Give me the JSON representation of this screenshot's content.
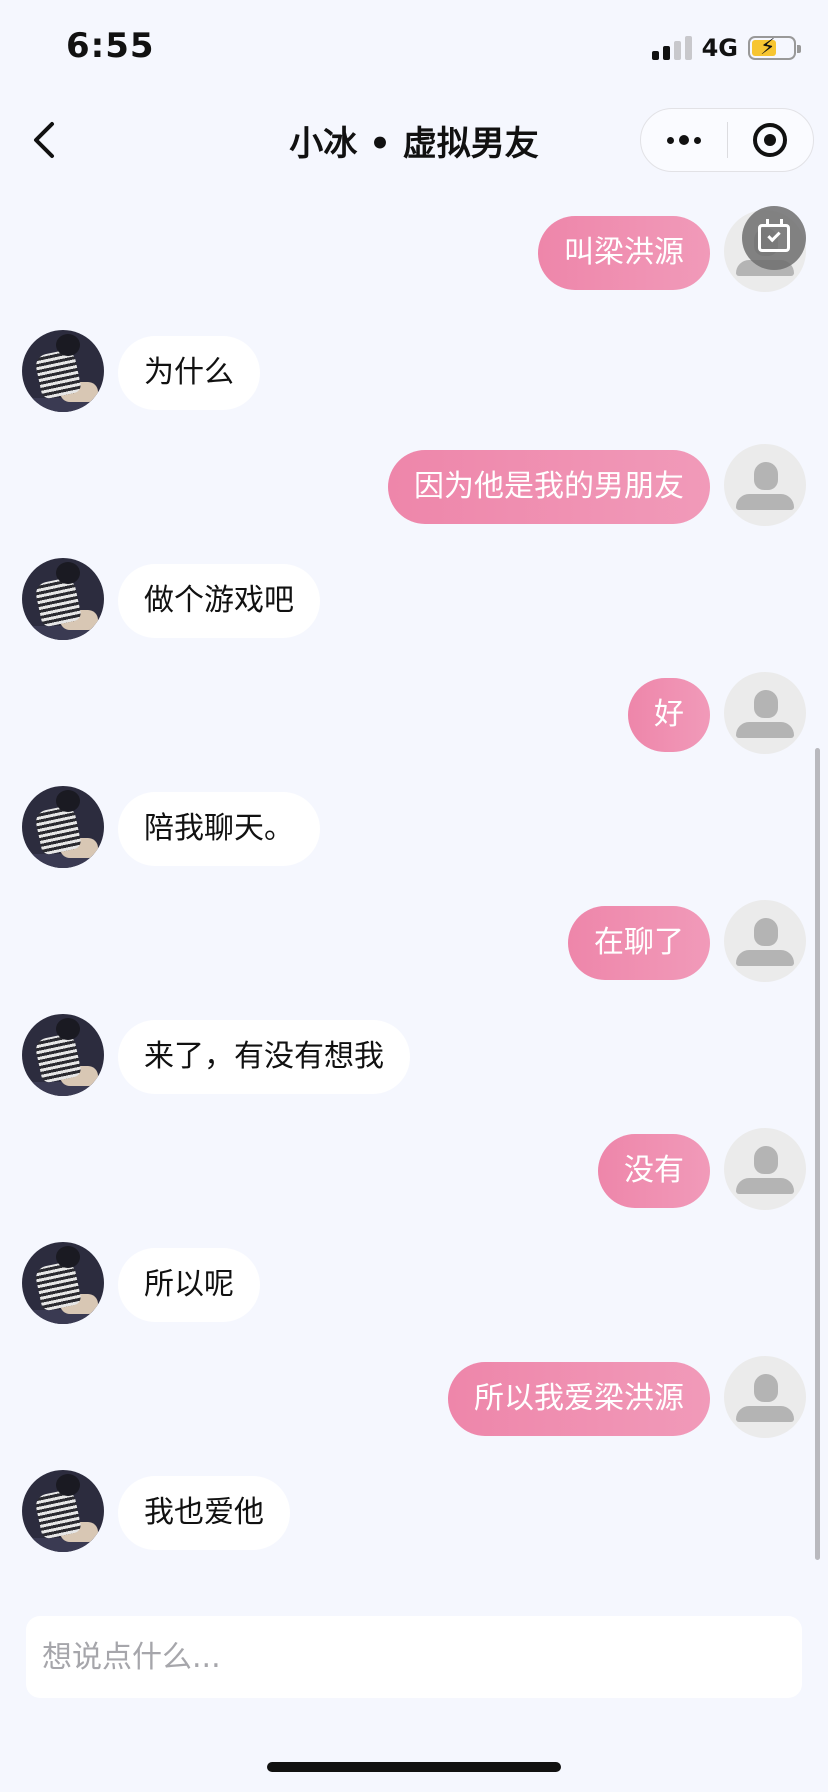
{
  "status_bar": {
    "time": "6:55",
    "network": "4G",
    "signal_bars_active": 2,
    "battery_charging": true
  },
  "header": {
    "title": "小冰 • 虚拟男友",
    "back_icon": "chevron-left-icon",
    "more_icon": "more-dots-icon",
    "close_icon": "record-target-icon"
  },
  "messages": [
    {
      "sender": "user",
      "text": "叫梁洪源"
    },
    {
      "sender": "bot",
      "text": "为什么"
    },
    {
      "sender": "user",
      "text": "因为他是我的男朋友"
    },
    {
      "sender": "bot",
      "text": "做个游戏吧"
    },
    {
      "sender": "user",
      "text": "好"
    },
    {
      "sender": "bot",
      "text": "陪我聊天。"
    },
    {
      "sender": "user",
      "text": "在聊了"
    },
    {
      "sender": "bot",
      "text": "来了，有没有想我"
    },
    {
      "sender": "user",
      "text": "没有"
    },
    {
      "sender": "bot",
      "text": "所以呢"
    },
    {
      "sender": "user",
      "text": "所以我爱梁洪源"
    },
    {
      "sender": "bot",
      "text": "我也爱他"
    }
  ],
  "floating_button_icon": "calendar-check-icon",
  "input": {
    "placeholder": "想说点什么...",
    "value": ""
  },
  "colors": {
    "background": "#f5f7fe",
    "user_bubble": "#ee86aa",
    "bot_bubble": "#ffffff"
  }
}
